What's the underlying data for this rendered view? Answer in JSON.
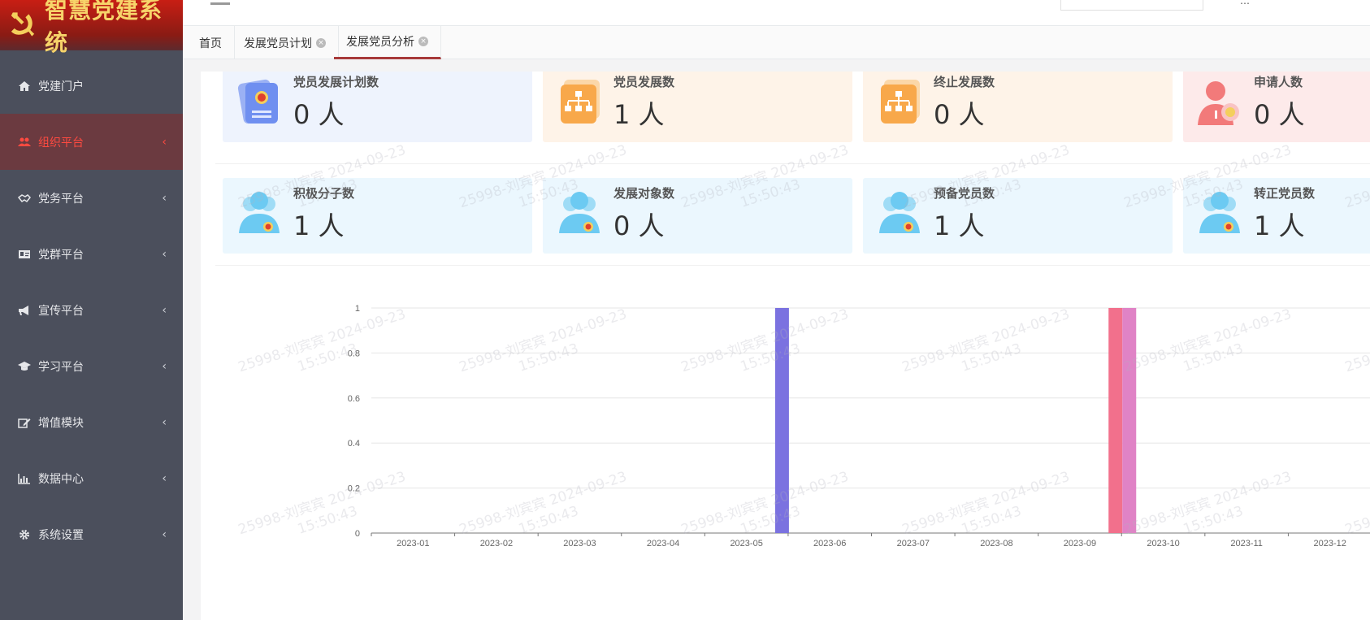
{
  "app": {
    "title": "智慧党建系统",
    "user_text": "…"
  },
  "sidebar": {
    "items": [
      {
        "label": "党建门户",
        "icon": "home-icon",
        "active": false,
        "has_arrow": false
      },
      {
        "label": "组织平台",
        "icon": "users-icon",
        "active": true,
        "has_arrow": true
      },
      {
        "label": "党务平台",
        "icon": "handshake-icon",
        "active": false,
        "has_arrow": true
      },
      {
        "label": "党群平台",
        "icon": "id-card-icon",
        "active": false,
        "has_arrow": true
      },
      {
        "label": "宣传平台",
        "icon": "bullhorn-icon",
        "active": false,
        "has_arrow": true
      },
      {
        "label": "学习平台",
        "icon": "graduation-cap-icon",
        "active": false,
        "has_arrow": true
      },
      {
        "label": "增值模块",
        "icon": "edit-icon",
        "active": false,
        "has_arrow": true
      },
      {
        "label": "数据中心",
        "icon": "bar-chart-icon",
        "active": false,
        "has_arrow": true
      },
      {
        "label": "系统设置",
        "icon": "gear-icon",
        "active": false,
        "has_arrow": true
      }
    ],
    "arrow_glyph": "‹"
  },
  "tabs": [
    {
      "label": "首页",
      "closable": false,
      "active": false
    },
    {
      "label": "发展党员计划",
      "closable": true,
      "active": false
    },
    {
      "label": "发展党员分析",
      "closable": true,
      "active": true
    }
  ],
  "stats_row1": [
    {
      "title": "党员发展计划数",
      "value": "0 人",
      "theme": "blue",
      "icon": "party-card-icon"
    },
    {
      "title": "党员发展数",
      "value": "1 人",
      "theme": "orange",
      "icon": "org-chart-icon"
    },
    {
      "title": "终止发展数",
      "value": "0 人",
      "theme": "orange",
      "icon": "org-chart-icon"
    },
    {
      "title": "申请人数",
      "value": "0 人",
      "theme": "pink",
      "icon": "applicant-icon"
    }
  ],
  "stats_row2": [
    {
      "title": "积极分子数",
      "value": "1 人",
      "theme": "cyan",
      "icon": "group-icon"
    },
    {
      "title": "发展对象数",
      "value": "0 人",
      "theme": "cyan",
      "icon": "group-icon"
    },
    {
      "title": "预备党员数",
      "value": "1 人",
      "theme": "cyan",
      "icon": "group-icon"
    },
    {
      "title": "转正党员数",
      "value": "1 人",
      "theme": "cyan",
      "icon": "group-icon"
    }
  ],
  "watermark": {
    "line1": "25998-刘宾宾 2024-09-23",
    "line2": "15:50:43"
  },
  "colors": {
    "accent": "#a83a3a",
    "sidebar_bg": "#4b4f5c",
    "active_text": "#ff4a40"
  },
  "chart_data": {
    "type": "bar",
    "categories": [
      "2023-01",
      "2023-02",
      "2023-03",
      "2023-04",
      "2023-05",
      "2023-06",
      "2023-07",
      "2023-08",
      "2023-09",
      "2023-10",
      "2023-11",
      "2023-12"
    ],
    "yticks": [
      "0",
      "0.2",
      "0.4",
      "0.6",
      "0.8",
      "1"
    ],
    "ylim": [
      0,
      1
    ],
    "grid": true,
    "series": [
      {
        "color": "#7b72e0",
        "values": [
          0,
          0,
          0,
          0,
          1,
          0,
          0,
          0,
          0,
          0,
          0,
          0
        ]
      },
      {
        "color": "#f2708c",
        "values": [
          0,
          0,
          0,
          0,
          0,
          0,
          0,
          0,
          1,
          0,
          0,
          0
        ]
      },
      {
        "color": "#e083c6",
        "values": [
          0,
          0,
          0,
          0,
          0,
          0,
          0,
          0,
          1,
          0,
          0,
          0
        ]
      }
    ]
  }
}
